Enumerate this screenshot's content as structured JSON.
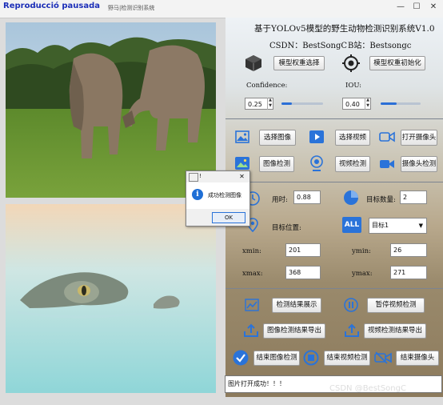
{
  "window": {
    "overlay_text": "Reproducció pausada",
    "title": "野马|检测识别系统",
    "menu": "·····  ·   ·····",
    "minimize": "—",
    "maximize": "☐",
    "close": "✕"
  },
  "header": {
    "title": "基于YOLOv5模型的野生动物检测识别系统V1.0",
    "csdn": "CSDN：BestSongC",
    "bilibili": "B站：Bestsongc"
  },
  "model": {
    "select_label": "模型权重选择",
    "init_label": "模型权重初始化"
  },
  "params": {
    "confidence_label": "Confidence:",
    "confidence_value": "0.25",
    "confidence_level": 0.25,
    "iou_label": "IOU:",
    "iou_value": "0.40",
    "iou_level": 0.4
  },
  "actions": {
    "select_image": "选择图像",
    "select_video": "选择视频",
    "open_camera": "打开摄像头",
    "image_detect": "图像检测",
    "video_detect": "视频检测",
    "camera_detect": "摄像头检测"
  },
  "results": {
    "time_label": "用时:",
    "time_value": "0.88",
    "count_label": "目标数量:",
    "count_value": "2",
    "position_label": "目标位置:",
    "target_select": "目标1",
    "xmin_label": "xmin:",
    "xmin_value": "201",
    "ymin_label": "ymin:",
    "ymin_value": "26",
    "xmax_label": "xmax:",
    "xmax_value": "368",
    "ymax_label": "ymax:",
    "ymax_value": "271"
  },
  "bottom_actions": {
    "show_results": "检测结果展示",
    "pause_video": "暂停视频检测",
    "export_image": "图像检测结果导出",
    "export_video": "视频检测结果导出",
    "end_image": "结束图像检测",
    "end_video": "结束视频检测",
    "end_camera": "结束摄像头"
  },
  "status_text": "图片打开成功！！！",
  "watermark": "CSDN @BestSongC",
  "dialog": {
    "title": "!",
    "message": "成功检测图像",
    "ok": "OK",
    "close": "✕"
  },
  "colors": {
    "icon_blue": "#2a73d9",
    "dialog_icon": "#1f6fd6",
    "overlay": "#1c2fb8"
  }
}
